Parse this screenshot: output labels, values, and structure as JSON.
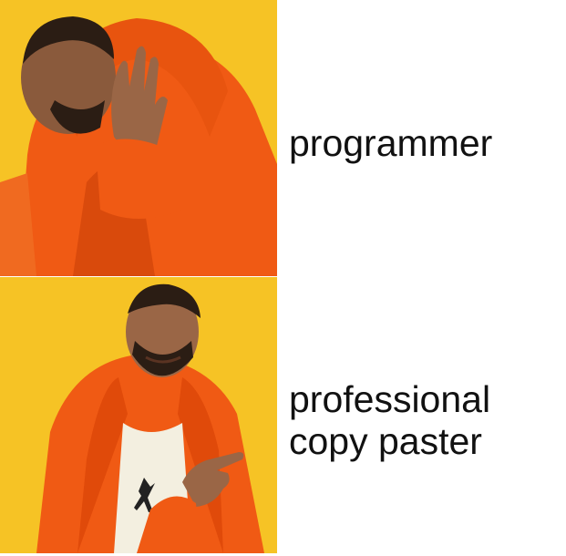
{
  "meme": {
    "top_caption": "programmer",
    "bottom_caption_line1": "professional",
    "bottom_caption_line2": "copy paster"
  },
  "colors": {
    "panel_background": "#f6c325",
    "jacket": "#f05a14",
    "text": "#111111"
  }
}
